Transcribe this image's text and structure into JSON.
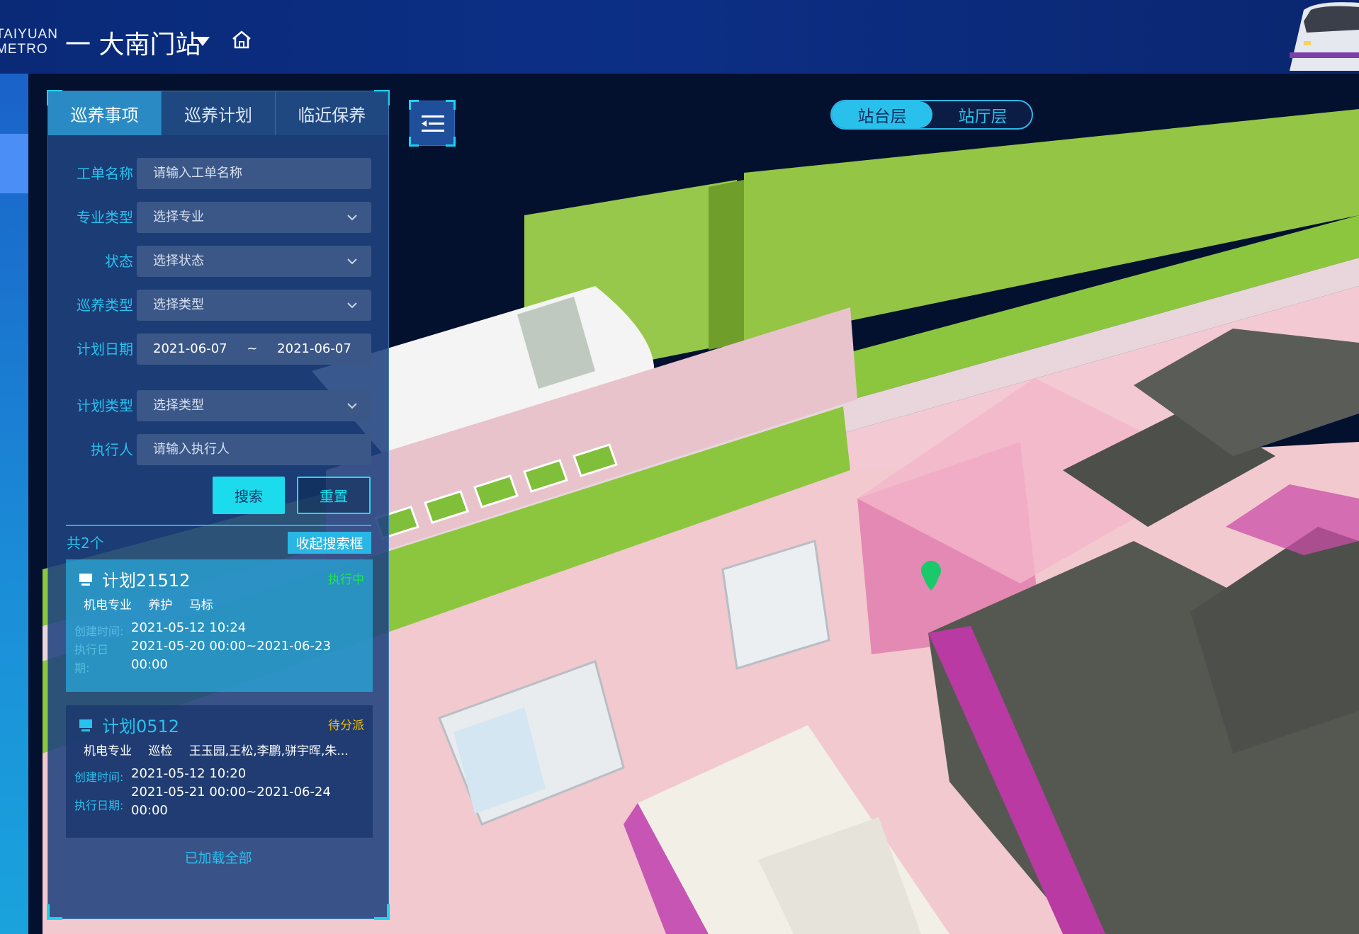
{
  "header": {
    "logo_line1": "TAIYUAN",
    "logo_line2": "METRO",
    "station_title": "一 大南门站",
    "icons": [
      "chevron-down-icon",
      "home-icon"
    ]
  },
  "panel": {
    "tabs": [
      {
        "label": "巡养事项",
        "active": true
      },
      {
        "label": "巡养计划",
        "active": false
      },
      {
        "label": "临近保养",
        "active": false
      }
    ],
    "filters": {
      "order_name": {
        "label": "工单名称",
        "placeholder": "请输入工单名称"
      },
      "specialty": {
        "label": "专业类型",
        "value": "选择专业"
      },
      "status": {
        "label": "状态",
        "value": "选择状态"
      },
      "patrol_type": {
        "label": "巡养类型",
        "value": "选择类型"
      },
      "plan_date": {
        "label": "计划日期",
        "start": "2021-06-07",
        "separator": "~",
        "end": "2021-06-07"
      },
      "plan_type": {
        "label": "计划类型",
        "value": "选择类型"
      },
      "executor": {
        "label": "执行人",
        "placeholder": "请输入执行人"
      }
    },
    "buttons": {
      "search": "搜索",
      "reset": "重置",
      "collapse": "收起搜索框"
    },
    "result_count": "共2个",
    "results": [
      {
        "name": "计划21512",
        "status": "执行中",
        "status_color": "#1ee64a",
        "tags": [
          "机电专业",
          "养护",
          "马标"
        ],
        "created_label": "创建时间:",
        "created": "2021-05-12 10:24",
        "exec_label_1": "执行日",
        "exec_label_2": "期:",
        "exec_line1": "2021-05-20 00:00~2021-06-23",
        "exec_line2": "00:00",
        "selected": true
      },
      {
        "name": "计划0512",
        "status": "待分派",
        "status_color": "#f2c200",
        "tags": [
          "机电专业",
          "巡检",
          "王玉园,王松,李鹏,骈宇晖,朱..."
        ],
        "created_label": "创建时间:",
        "created": "2021-05-12 10:20",
        "exec_label": "执行日期:",
        "exec_line1": "2021-05-21 00:00~2021-06-24",
        "exec_line2": "00:00",
        "selected": false
      }
    ],
    "loaded_all": "已加载全部"
  },
  "level_switch": {
    "options": [
      "站台层",
      "站厅层"
    ],
    "active": "站台层"
  },
  "scene": {
    "marker_color": "#19c96a"
  },
  "colors": {
    "accent": "#1bdbec",
    "label": "#27c2ee",
    "header_bg": "#0b2c80"
  }
}
